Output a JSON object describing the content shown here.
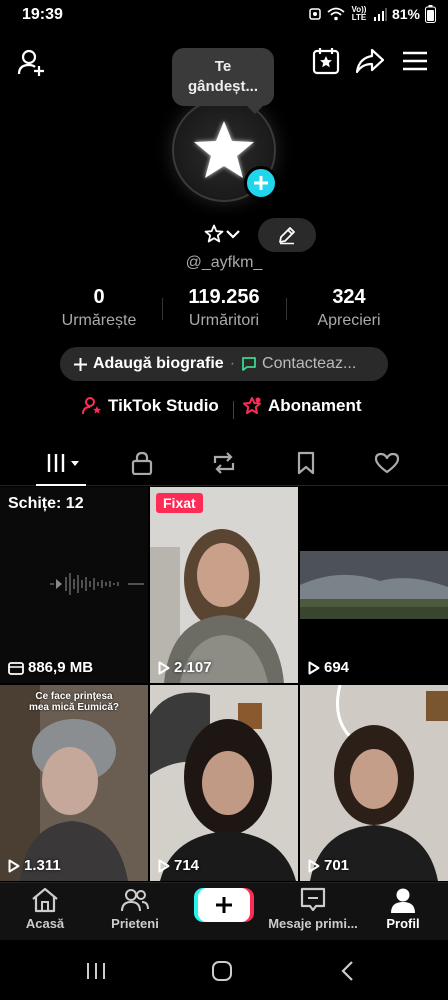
{
  "status_bar": {
    "time": "19:39",
    "network": "Vo)) LTE",
    "battery": "81%"
  },
  "profile": {
    "thought_bubble": [
      "Te",
      "gândeșt..."
    ],
    "username": "@_ayfkm_",
    "stats": [
      {
        "value": "0",
        "label": "Urmărește"
      },
      {
        "value": "119.256",
        "label": "Urmăritori"
      },
      {
        "value": "324",
        "label": "Aprecieri"
      }
    ],
    "add_bio": "Adaugă biografie",
    "separator_dot": "·",
    "contact": "Contacteaz...",
    "tiktok_studio": "TikTok Studio",
    "subscription": "Abonament"
  },
  "tabs": [
    "videos-tab",
    "private-tab",
    "reposts-tab",
    "favorites-tab",
    "liked-tab"
  ],
  "grid": {
    "drafts": {
      "label": "Schițe: 12",
      "size": "886,9 MB"
    },
    "pinned_label": "Fixat",
    "videos": [
      {
        "views": "2.107",
        "pinned": true
      },
      {
        "views": "694"
      },
      {
        "views": "1.311",
        "caption": "Ce face prințesa mea mică Eumică?"
      },
      {
        "views": "714"
      },
      {
        "views": "701"
      }
    ]
  },
  "bottom_nav": [
    {
      "label": "Acasă",
      "icon": "home-icon"
    },
    {
      "label": "Prieteni",
      "icon": "friends-icon"
    },
    {
      "label": "",
      "icon": "plus-icon"
    },
    {
      "label": "Mesaje primi...",
      "icon": "inbox-icon"
    },
    {
      "label": "Profil",
      "icon": "profile-icon"
    }
  ],
  "colors": {
    "accent_cyan": "#20d5ec",
    "accent_pink": "#fe2c55",
    "background": "#000000"
  }
}
